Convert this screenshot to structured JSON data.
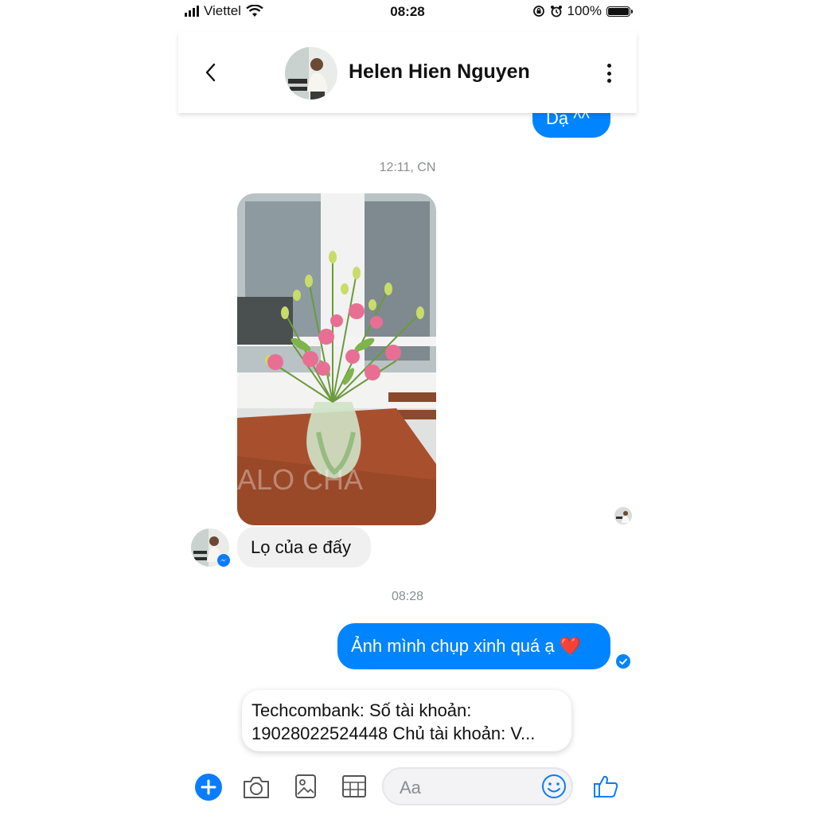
{
  "status_bar": {
    "carrier": "Viettel",
    "time": "08:28",
    "battery": "100%"
  },
  "header": {
    "contact_name": "Helen Hien Nguyen"
  },
  "messages": {
    "prev_outgoing": "Dạ ^^",
    "timestamp_1": "12:11, CN",
    "photo_watermark": "ALO CHA",
    "incoming_text": "Lọ của e đấy",
    "timestamp_2": "08:28",
    "outgoing_text": "Ảnh mình chụp xinh quá ạ",
    "outgoing_emoji": "❤️"
  },
  "preview_card": {
    "line1": "Techcombank: Số tài khoản:",
    "line2": "19028022524448 Chủ tài khoản: V..."
  },
  "composer": {
    "placeholder": "Aa"
  },
  "colors": {
    "accent": "#0084ff",
    "incoming_bubble": "#f0f0f0",
    "timestamp": "#8a8d91"
  },
  "icons": [
    "signal-icon",
    "wifi-icon",
    "lock-rotation-icon",
    "alarm-icon",
    "battery-icon",
    "back-chevron-icon",
    "more-vertical-icon",
    "messenger-badge-icon",
    "seen-check-icon",
    "plus-icon",
    "camera-icon",
    "gallery-icon",
    "sticker-grid-icon",
    "emoji-icon",
    "like-icon"
  ]
}
